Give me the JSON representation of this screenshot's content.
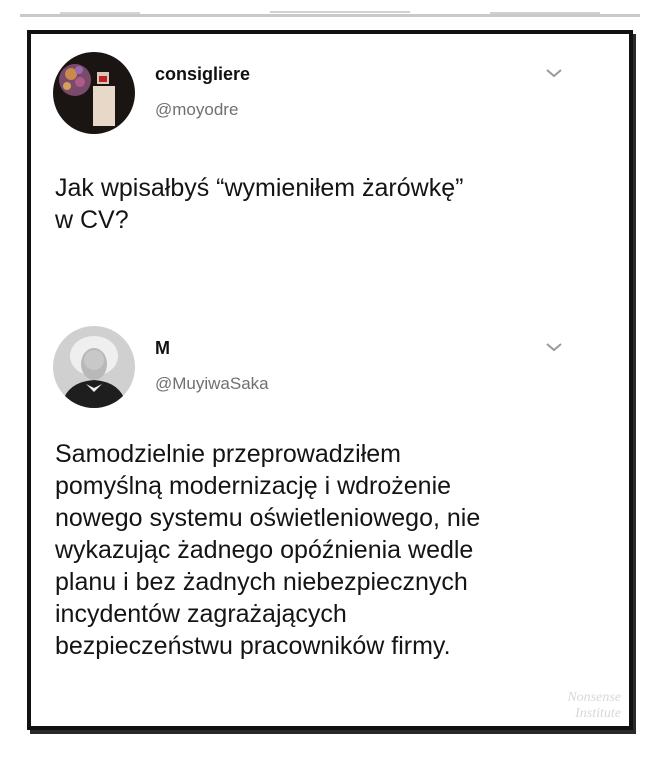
{
  "tweets": [
    {
      "author_name": "consigliere",
      "author_handle": "@moyodre",
      "avatar_icon": "avatar-illustration-icon",
      "menu_icon": "chevron-down-icon",
      "text": "Jak wpisałbyś “wymieniłem żarówkę”\nw CV?"
    },
    {
      "author_name": "M",
      "author_handle": "@MuyiwaSaka",
      "avatar_icon": "avatar-portrait-icon",
      "menu_icon": "chevron-down-icon",
      "text": "Samodzielnie przeprowadziłem\npomyślną modernizację i wdrożenie\nnowego systemu oświetleniowego, nie\nwykazując żadnego opóźnienia wedle\nplanu i bez żadnych niebezpiecznych\nincydentów zagrażających\nbezpieczeństwu pracowników firmy."
    }
  ],
  "watermark": "Nonsense\nInstitute",
  "colors": {
    "frame": "#111111",
    "text": "#141414",
    "handle": "#707070",
    "chevron": "#9a9a9a"
  }
}
